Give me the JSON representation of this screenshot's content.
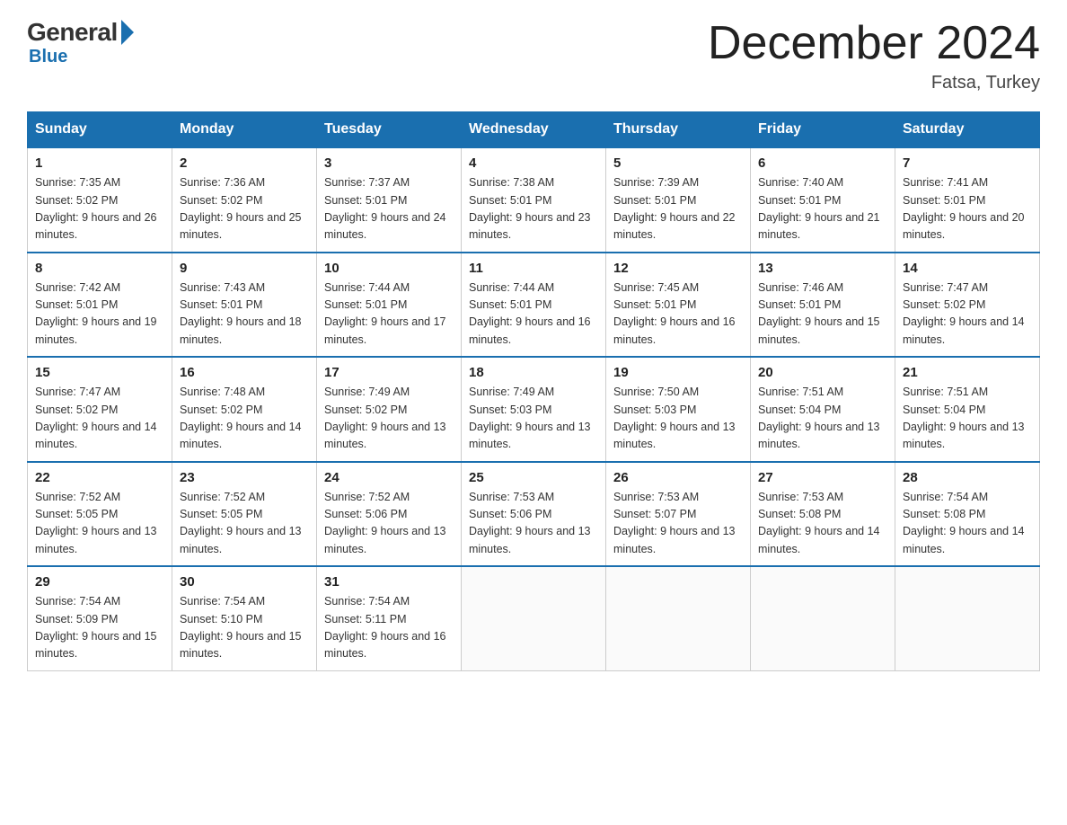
{
  "logo": {
    "general": "General",
    "blue": "Blue"
  },
  "title": "December 2024",
  "subtitle": "Fatsa, Turkey",
  "days_of_week": [
    "Sunday",
    "Monday",
    "Tuesday",
    "Wednesday",
    "Thursday",
    "Friday",
    "Saturday"
  ],
  "weeks": [
    [
      {
        "num": "1",
        "sunrise": "7:35 AM",
        "sunset": "5:02 PM",
        "daylight": "9 hours and 26 minutes."
      },
      {
        "num": "2",
        "sunrise": "7:36 AM",
        "sunset": "5:02 PM",
        "daylight": "9 hours and 25 minutes."
      },
      {
        "num": "3",
        "sunrise": "7:37 AM",
        "sunset": "5:01 PM",
        "daylight": "9 hours and 24 minutes."
      },
      {
        "num": "4",
        "sunrise": "7:38 AM",
        "sunset": "5:01 PM",
        "daylight": "9 hours and 23 minutes."
      },
      {
        "num": "5",
        "sunrise": "7:39 AM",
        "sunset": "5:01 PM",
        "daylight": "9 hours and 22 minutes."
      },
      {
        "num": "6",
        "sunrise": "7:40 AM",
        "sunset": "5:01 PM",
        "daylight": "9 hours and 21 minutes."
      },
      {
        "num": "7",
        "sunrise": "7:41 AM",
        "sunset": "5:01 PM",
        "daylight": "9 hours and 20 minutes."
      }
    ],
    [
      {
        "num": "8",
        "sunrise": "7:42 AM",
        "sunset": "5:01 PM",
        "daylight": "9 hours and 19 minutes."
      },
      {
        "num": "9",
        "sunrise": "7:43 AM",
        "sunset": "5:01 PM",
        "daylight": "9 hours and 18 minutes."
      },
      {
        "num": "10",
        "sunrise": "7:44 AM",
        "sunset": "5:01 PM",
        "daylight": "9 hours and 17 minutes."
      },
      {
        "num": "11",
        "sunrise": "7:44 AM",
        "sunset": "5:01 PM",
        "daylight": "9 hours and 16 minutes."
      },
      {
        "num": "12",
        "sunrise": "7:45 AM",
        "sunset": "5:01 PM",
        "daylight": "9 hours and 16 minutes."
      },
      {
        "num": "13",
        "sunrise": "7:46 AM",
        "sunset": "5:01 PM",
        "daylight": "9 hours and 15 minutes."
      },
      {
        "num": "14",
        "sunrise": "7:47 AM",
        "sunset": "5:02 PM",
        "daylight": "9 hours and 14 minutes."
      }
    ],
    [
      {
        "num": "15",
        "sunrise": "7:47 AM",
        "sunset": "5:02 PM",
        "daylight": "9 hours and 14 minutes."
      },
      {
        "num": "16",
        "sunrise": "7:48 AM",
        "sunset": "5:02 PM",
        "daylight": "9 hours and 14 minutes."
      },
      {
        "num": "17",
        "sunrise": "7:49 AM",
        "sunset": "5:02 PM",
        "daylight": "9 hours and 13 minutes."
      },
      {
        "num": "18",
        "sunrise": "7:49 AM",
        "sunset": "5:03 PM",
        "daylight": "9 hours and 13 minutes."
      },
      {
        "num": "19",
        "sunrise": "7:50 AM",
        "sunset": "5:03 PM",
        "daylight": "9 hours and 13 minutes."
      },
      {
        "num": "20",
        "sunrise": "7:51 AM",
        "sunset": "5:04 PM",
        "daylight": "9 hours and 13 minutes."
      },
      {
        "num": "21",
        "sunrise": "7:51 AM",
        "sunset": "5:04 PM",
        "daylight": "9 hours and 13 minutes."
      }
    ],
    [
      {
        "num": "22",
        "sunrise": "7:52 AM",
        "sunset": "5:05 PM",
        "daylight": "9 hours and 13 minutes."
      },
      {
        "num": "23",
        "sunrise": "7:52 AM",
        "sunset": "5:05 PM",
        "daylight": "9 hours and 13 minutes."
      },
      {
        "num": "24",
        "sunrise": "7:52 AM",
        "sunset": "5:06 PM",
        "daylight": "9 hours and 13 minutes."
      },
      {
        "num": "25",
        "sunrise": "7:53 AM",
        "sunset": "5:06 PM",
        "daylight": "9 hours and 13 minutes."
      },
      {
        "num": "26",
        "sunrise": "7:53 AM",
        "sunset": "5:07 PM",
        "daylight": "9 hours and 13 minutes."
      },
      {
        "num": "27",
        "sunrise": "7:53 AM",
        "sunset": "5:08 PM",
        "daylight": "9 hours and 14 minutes."
      },
      {
        "num": "28",
        "sunrise": "7:54 AM",
        "sunset": "5:08 PM",
        "daylight": "9 hours and 14 minutes."
      }
    ],
    [
      {
        "num": "29",
        "sunrise": "7:54 AM",
        "sunset": "5:09 PM",
        "daylight": "9 hours and 15 minutes."
      },
      {
        "num": "30",
        "sunrise": "7:54 AM",
        "sunset": "5:10 PM",
        "daylight": "9 hours and 15 minutes."
      },
      {
        "num": "31",
        "sunrise": "7:54 AM",
        "sunset": "5:11 PM",
        "daylight": "9 hours and 16 minutes."
      },
      null,
      null,
      null,
      null
    ]
  ]
}
